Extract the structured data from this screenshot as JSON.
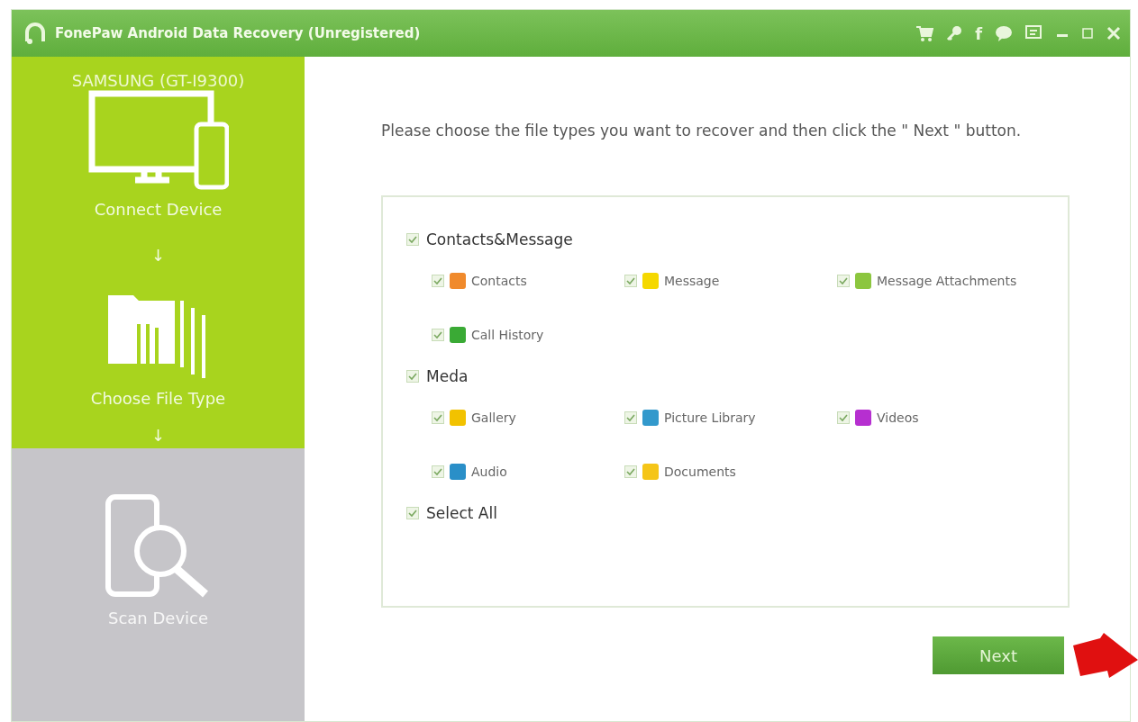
{
  "window": {
    "title": "FonePaw Android Data Recovery (Unregistered)",
    "toolbar_glyph": "f"
  },
  "sidebar": {
    "device": "SAMSUNG (GT-I9300)",
    "arrows": [
      "↓",
      "↓"
    ],
    "steps": [
      {
        "kind": "connect",
        "label": "Connect Device",
        "completed": true
      },
      {
        "kind": "choose",
        "label": "Choose File Type",
        "completed": true
      },
      {
        "kind": "scan",
        "label": "Scan Device",
        "completed": false
      }
    ]
  },
  "content": {
    "instruction": "Please choose the file types you want to recover and then click the \" Next \" button.",
    "groups": [
      {
        "label": "Contacts&Message",
        "checked": true,
        "items": [
          {
            "label": "Contacts",
            "checked": true,
            "color": "#f08a2c"
          },
          {
            "label": "Message",
            "checked": true,
            "color": "#f5d800"
          },
          {
            "label": "Message Attachments",
            "checked": true,
            "color": "#8cc63f"
          },
          {
            "label": "Call History",
            "checked": true,
            "color": "#3aaa35"
          }
        ]
      },
      {
        "label": "Meda",
        "checked": true,
        "items": [
          {
            "label": "Gallery",
            "checked": true,
            "color": "#f2c200"
          },
          {
            "label": "Picture Library",
            "checked": true,
            "color": "#3399cc"
          },
          {
            "label": "Videos",
            "checked": true,
            "color": "#b62fd0"
          },
          {
            "label": "Audio",
            "checked": true,
            "color": "#2a8fc8"
          },
          {
            "label": "Documents",
            "checked": true,
            "color": "#f5c518"
          }
        ]
      }
    ],
    "select_all": {
      "label": "Select All",
      "checked": true
    },
    "next_button": "Next"
  }
}
